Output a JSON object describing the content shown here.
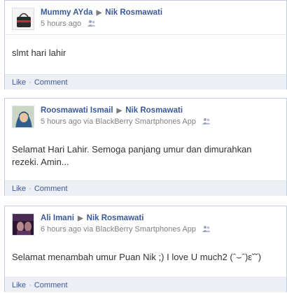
{
  "posts": [
    {
      "author": "Mummy AYda",
      "target": "Nik Rosmawati",
      "time": "5 hours ago",
      "via": "",
      "message": "slmt hari lahir",
      "like_label": "Like",
      "comment_label": "Comment"
    },
    {
      "author": "Roosmawati Ismail",
      "target": "Nik Rosmawati",
      "time": "5 hours ago",
      "via": "via BlackBerry Smartphones App",
      "message": "Selamat Hari Lahir. Semoga panjang umur dan dimurahkan rezeki. Amin...",
      "like_label": "Like",
      "comment_label": "Comment"
    },
    {
      "author": "Ali Imani",
      "target": "Nik Rosmawati",
      "time": "6 hours ago",
      "via": "via BlackBerry Smartphones App",
      "message": "Selamat menambah umur Puan Nik ;) I love U much2 (ˆ⌣ˆ)ε˘˘)",
      "like_label": "Like",
      "comment_label": "Comment"
    }
  ],
  "colors": {
    "link": "#3b5998",
    "meta": "#808080",
    "action_bar": "#edeff4",
    "border": "#c4cde0"
  },
  "icons": {
    "arrow": "right-arrow-icon",
    "audience": "friends-audience-icon"
  }
}
